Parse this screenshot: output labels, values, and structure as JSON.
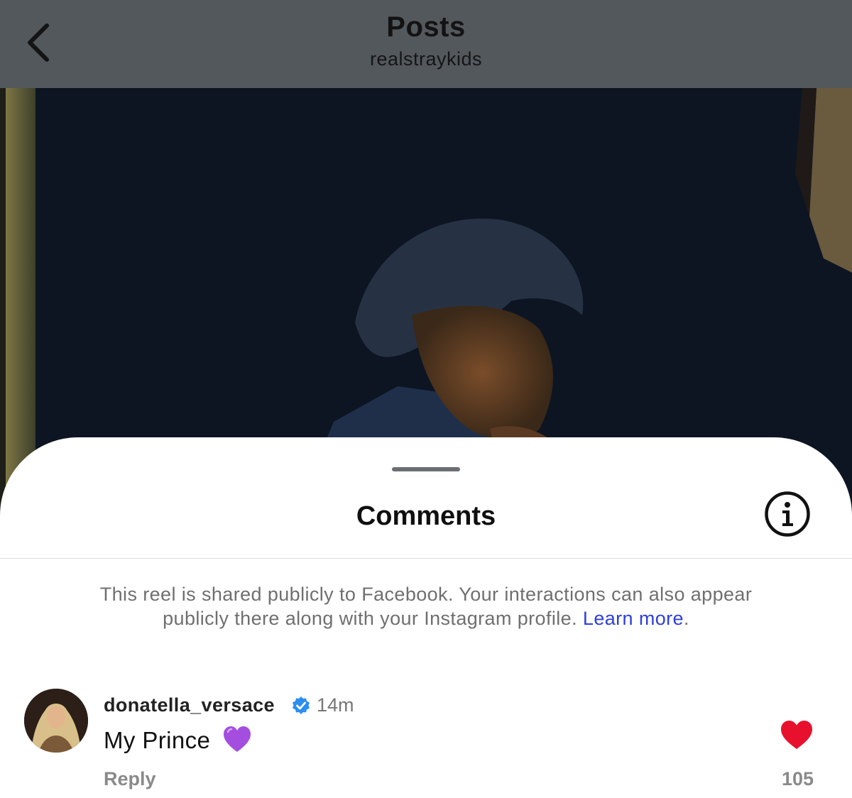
{
  "header": {
    "title": "Posts",
    "subtitle": "realstraykids",
    "back_icon": "chevron-left-icon"
  },
  "sheet": {
    "title": "Comments",
    "info_icon": "info-circle-icon",
    "notice_text": "This reel is shared publicly to Facebook. Your interactions can also appear publicly there along with your Instagram profile.",
    "learn_more": "Learn more",
    "notice_end": "."
  },
  "comment": {
    "username": "donatella_versace",
    "verified_icon": "verified-badge-icon",
    "time": "14m",
    "text": "My Prince",
    "emoji": "purple-heart-emoji",
    "reply_label": "Reply",
    "like_icon": "heart-filled-icon",
    "like_count": "105"
  },
  "colors": {
    "topbar": "#53585d",
    "link": "#2f3fd6",
    "like": "#e8112d",
    "verified": "#2b8ef0",
    "emoji": "#a44ee0"
  }
}
